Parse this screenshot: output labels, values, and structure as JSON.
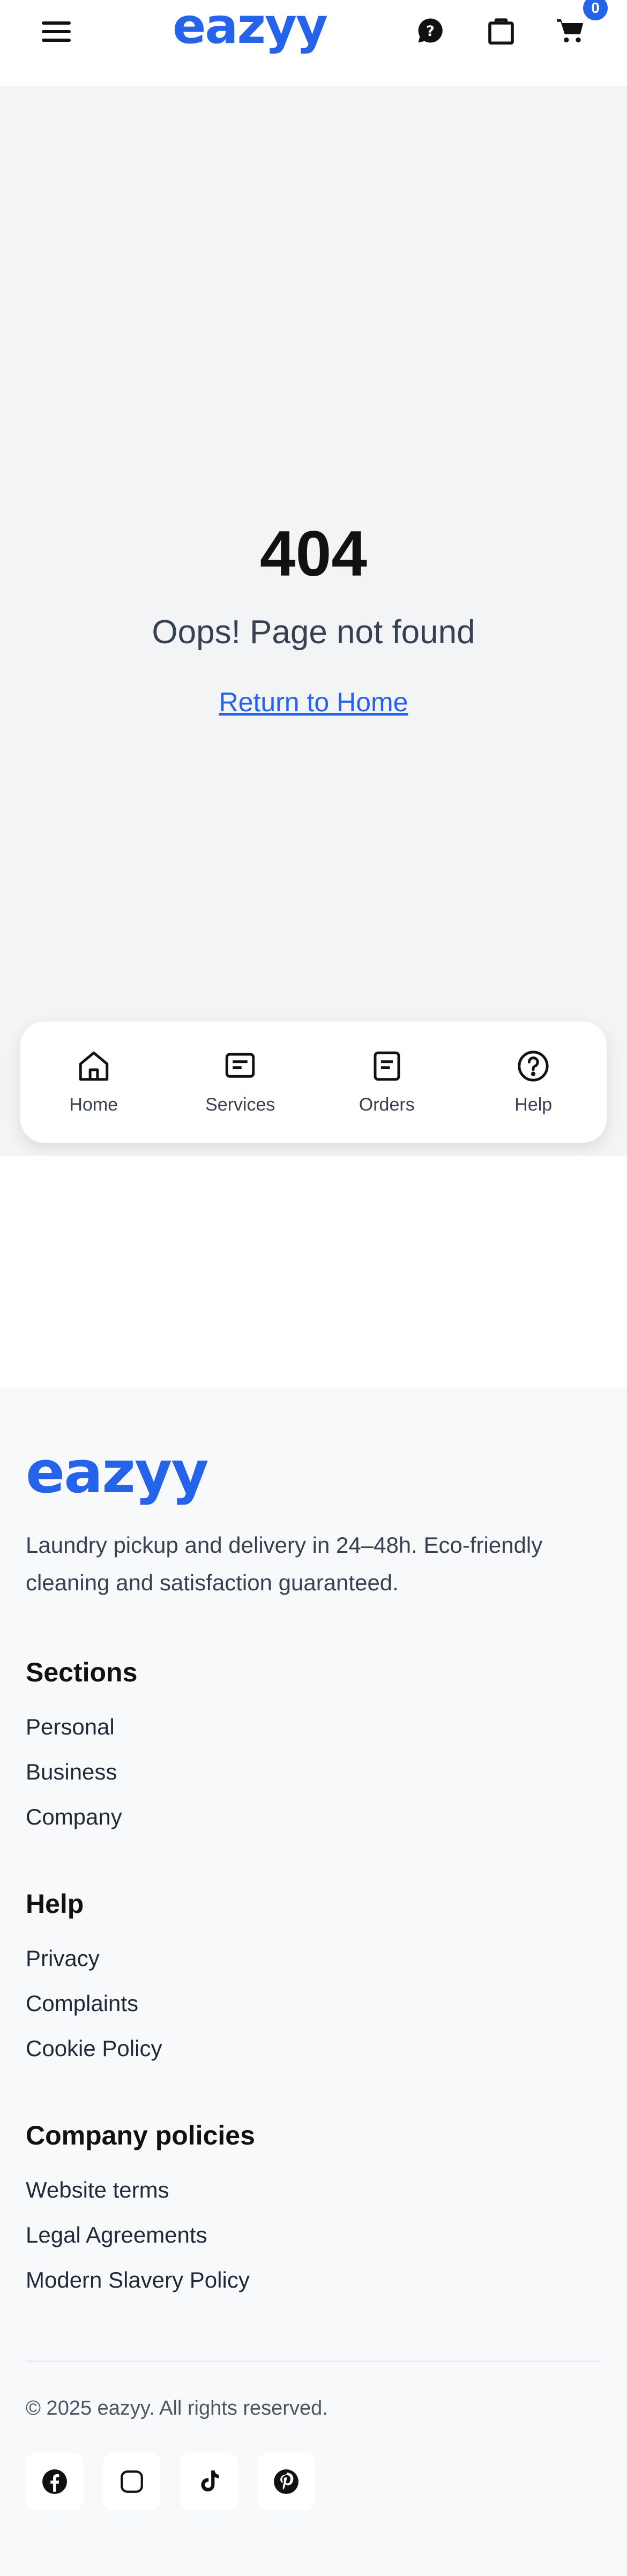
{
  "brand": {
    "name": "eazyy",
    "color": "#2563eb"
  },
  "header": {
    "icons": [
      "menu-icon",
      "help-chat-icon",
      "bag-icon",
      "cart-icon"
    ],
    "cart_count": "0"
  },
  "error": {
    "code": "404",
    "message": "Oops! Page not found",
    "link_label": "Return to Home"
  },
  "bottom_nav": {
    "items": [
      {
        "label": "Home",
        "icon": "home-icon"
      },
      {
        "label": "Services",
        "icon": "services-icon"
      },
      {
        "label": "Orders",
        "icon": "orders-icon"
      },
      {
        "label": "Help",
        "icon": "help-icon"
      }
    ]
  },
  "footer": {
    "tagline": "Laundry pickup and delivery in 24–48h. Eco-friendly cleaning and satisfaction guaranteed.",
    "sections": [
      {
        "heading": "Sections",
        "links": [
          "Personal",
          "Business",
          "Company"
        ]
      },
      {
        "heading": "Help",
        "links": [
          "Privacy",
          "Complaints",
          "Cookie Policy"
        ]
      },
      {
        "heading": "Company policies",
        "links": [
          "Website terms",
          "Legal Agreements",
          "Modern Slavery Policy"
        ]
      }
    ],
    "copyright": "© 2025 eazyy. All rights reserved.",
    "social": [
      "facebook-icon",
      "instagram-icon",
      "tiktok-icon",
      "pinterest-icon"
    ]
  }
}
